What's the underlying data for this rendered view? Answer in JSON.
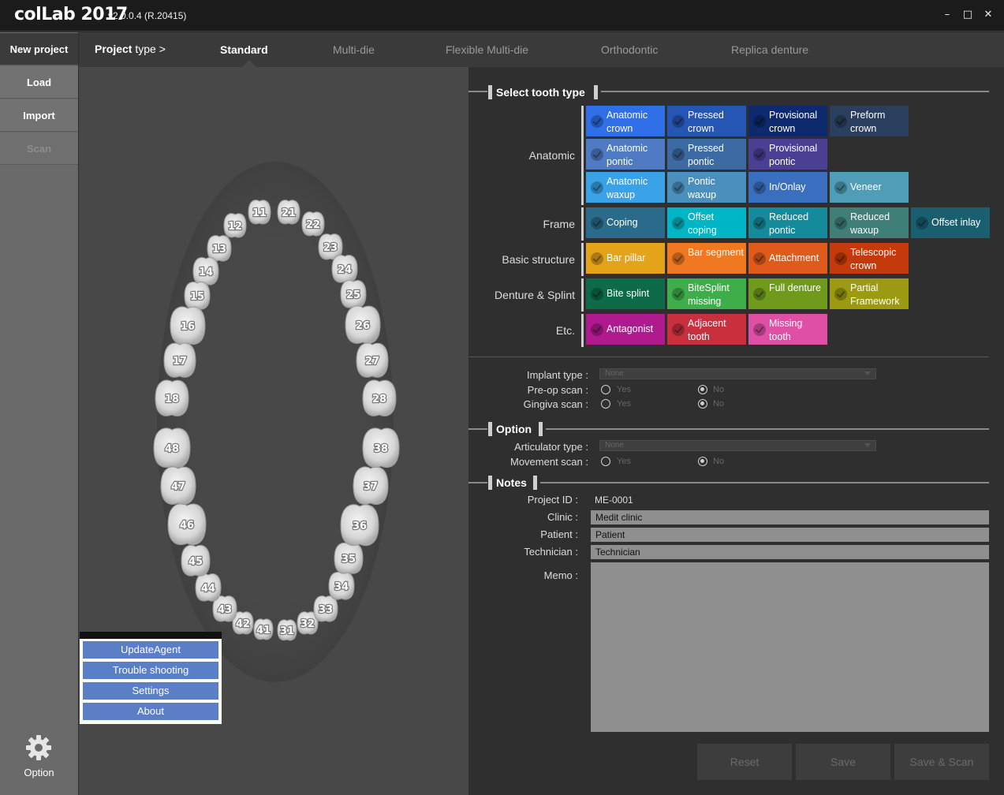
{
  "titlebar": {
    "logo": "colLab 2017",
    "version": "v2.0.0.4  (R.20415)",
    "minimize_icon": "–",
    "maximize_icon": "□",
    "close_icon": "✕"
  },
  "sidebar": {
    "items": [
      {
        "label": "New project"
      },
      {
        "label": "Load"
      },
      {
        "label": "Import"
      },
      {
        "label": "Scan"
      }
    ],
    "option_label": "Option"
  },
  "tabbar": {
    "project_type_bold": "Project",
    "project_type_rest": " type >",
    "tabs": [
      {
        "label": "Standard"
      },
      {
        "label": "Multi-die"
      },
      {
        "label": "Flexible Multi-die"
      },
      {
        "label": "Orthodontic"
      },
      {
        "label": "Replica denture"
      }
    ]
  },
  "teeth": {
    "upper": [
      "11",
      "12",
      "13",
      "14",
      "15",
      "16",
      "17",
      "18",
      "21",
      "22",
      "23",
      "24",
      "25",
      "26",
      "27",
      "28"
    ],
    "lower": [
      "31",
      "32",
      "33",
      "34",
      "35",
      "36",
      "37",
      "38",
      "41",
      "42",
      "43",
      "44",
      "45",
      "46",
      "47",
      "48"
    ]
  },
  "popup": {
    "items": [
      "UpdateAgent",
      "Trouble shooting",
      "Settings",
      "About"
    ]
  },
  "tooth_type": {
    "section_title": "Select tooth type",
    "categories": {
      "anatomic": "Anatomic",
      "frame": "Frame",
      "basic": "Basic structure",
      "denture": "Denture & Splint",
      "etc": "Etc."
    },
    "tiles": {
      "anatomic_crown": "Anatomic crown",
      "pressed_crown": "Pressed crown",
      "provisional_crown": "Provisional crown",
      "preform_crown": "Preform crown",
      "anatomic_pontic": "Anatomic pontic",
      "pressed_pontic": "Pressed pontic",
      "provisional_pontic": "Provisional pontic",
      "anatomic_waxup": "Anatomic waxup",
      "pontic_waxup": "Pontic waxup",
      "inonlay": "In/Onlay",
      "veneer": "Veneer",
      "coping": "Coping",
      "offset_coping": "Offset coping",
      "reduced_pontic": "Reduced pontic",
      "reduced_waxup": "Reduced waxup",
      "offset_inlay": "Offset inlay",
      "bar_pillar": "Bar pillar",
      "bar_segment": "Bar segment",
      "attachment": "Attachment",
      "telescopic_crown": "Telescopic crown",
      "bite_splint": "Bite splint",
      "bitesplint_missing": "BiteSplint missing",
      "full_denture": "Full denture",
      "partial_framework": "Partial Framework",
      "antagonist": "Antagonist",
      "adjacent_tooth": "Adjacent tooth",
      "missing_tooth": "Missing tooth"
    },
    "colors": {
      "anatomic_crown": "#2f6fe8",
      "pressed_crown": "#2656b3",
      "provisional_crown": "#0e2a6e",
      "preform_crown": "#2a3f5e",
      "anatomic_pontic": "#4f7bc4",
      "pressed_pontic": "#3c6aa3",
      "provisional_pontic": "#4b3f93",
      "anatomic_waxup": "#3aa2e6",
      "pontic_waxup": "#4b8fbd",
      "inonlay": "#3a6fc0",
      "veneer": "#4f9db6",
      "coping": "#2a6b8c",
      "offset_coping": "#00b5c5",
      "reduced_pontic": "#158a9a",
      "reduced_waxup": "#3f7f78",
      "offset_inlay": "#1a5f6f",
      "bar_pillar": "#e5a31a",
      "bar_segment": "#f07820",
      "attachment": "#e05a1c",
      "telescopic_crown": "#c43a0c",
      "bite_splint": "#0d6b4a",
      "bitesplint_missing": "#3fae4a",
      "full_denture": "#6f9a1c",
      "partial_framework": "#9b9a10",
      "antagonist": "#b01a8e",
      "adjacent_tooth": "#c8303e",
      "missing_tooth": "#e04fa6"
    }
  },
  "implant": {
    "implant_type_label": "Implant type :",
    "implant_type_value": "None",
    "preop_label": "Pre-op scan :",
    "gingiva_label": "Gingiva scan :",
    "yes": "Yes",
    "no": "No"
  },
  "option": {
    "section_title": "Option",
    "articulator_label": "Articulator type :",
    "articulator_value": "None",
    "movement_label": "Movement scan :"
  },
  "notes": {
    "section_title": "Notes",
    "project_id_label": "Project ID :",
    "project_id_value": "ME-0001",
    "clinic_label": "Clinic :",
    "clinic_value": "Medit clinic",
    "patient_label": "Patient :",
    "patient_value": "Patient",
    "technician_label": "Technician :",
    "technician_value": "Technician",
    "memo_label": "Memo :"
  },
  "actions": {
    "reset": "Reset",
    "save": "Save",
    "save_scan": "Save & Scan"
  }
}
